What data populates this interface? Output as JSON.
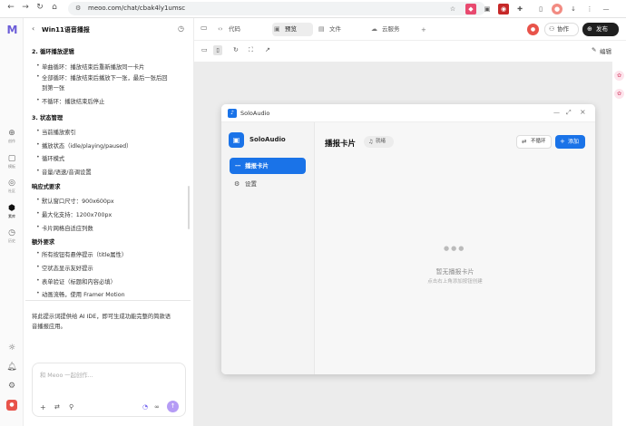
{
  "browser": {
    "url": "meoo.com/chat/cbak4ly1umsc"
  },
  "rail": {
    "items": [
      {
        "label": "创作",
        "icon": "plus-circle-icon"
      },
      {
        "label": "模板",
        "icon": "template-icon"
      },
      {
        "label": "社区",
        "icon": "community-icon"
      },
      {
        "label": "素库",
        "icon": "library-icon"
      },
      {
        "label": "历史",
        "icon": "history-icon"
      }
    ]
  },
  "chat": {
    "title": "Win11语音播报",
    "lines": [
      {
        "text": "2.  循环播放逻辑",
        "bold": true
      },
      {
        "text": "单曲循环：播放结束后重新播放同一卡片",
        "bullet": true
      },
      {
        "text": "全部循环：播放结束后播放下一张，最后一张后回",
        "bullet": true
      },
      {
        "text": "到第一张",
        "bullet": false
      },
      {
        "text": "不循环：播放结束后停止",
        "bullet": true
      },
      {
        "text": "3.  状态管理",
        "bold": true
      },
      {
        "text": "当前播放索引",
        "bullet": true
      },
      {
        "text": "播放状态（idle/playing/paused）",
        "bullet": true
      },
      {
        "text": "循环模式",
        "bullet": true
      },
      {
        "text": "音量/语速/音调设置",
        "bullet": true
      },
      {
        "text": "响应式要求",
        "bold": true
      },
      {
        "text": "默认窗口尺寸：900x600px",
        "bullet": true
      },
      {
        "text": "最大化支持：1200x700px",
        "bullet": true
      },
      {
        "text": "卡片网格自适应列数",
        "bullet": true
      },
      {
        "text": "额外要求",
        "bold": true
      },
      {
        "text": "所有按钮有悬停提示（title属性）",
        "bullet": true
      },
      {
        "text": "空状态显示友好提示",
        "bullet": true
      },
      {
        "text": "表单验证（标题和内容必填）",
        "bullet": true
      },
      {
        "text": "动画流畅，使用 Framer Motion",
        "bullet": true
      }
    ],
    "footer_text_1": "将此提示词提供给 AI IDE，即可生成功能完整的简款语",
    "footer_text_2": "音播报应用。",
    "composer_placeholder": "和 Meoo 一起创作..."
  },
  "topbar": {
    "tabs": [
      {
        "label": "代码",
        "icon": "code-icon"
      },
      {
        "label": "预览",
        "icon": "preview-icon"
      },
      {
        "label": "文件",
        "icon": "file-icon"
      },
      {
        "label": "云服务",
        "icon": "cloud-icon"
      }
    ],
    "collab_label": "协作",
    "publish_label": "发布",
    "edit_label": "编辑"
  },
  "app": {
    "window_title": "SoloAudio",
    "brand": "SoloAudio",
    "nav": [
      {
        "label": "播报卡片",
        "active": true
      },
      {
        "label": "设置",
        "active": false
      }
    ],
    "heading": "播报卡片",
    "status_badge": "就绪",
    "loop_button": "不循环",
    "add_button": "添加",
    "empty_title": "暂无播报卡片",
    "empty_hint": "点击右上角添加按钮创建",
    "accent": "#1a73e8"
  }
}
